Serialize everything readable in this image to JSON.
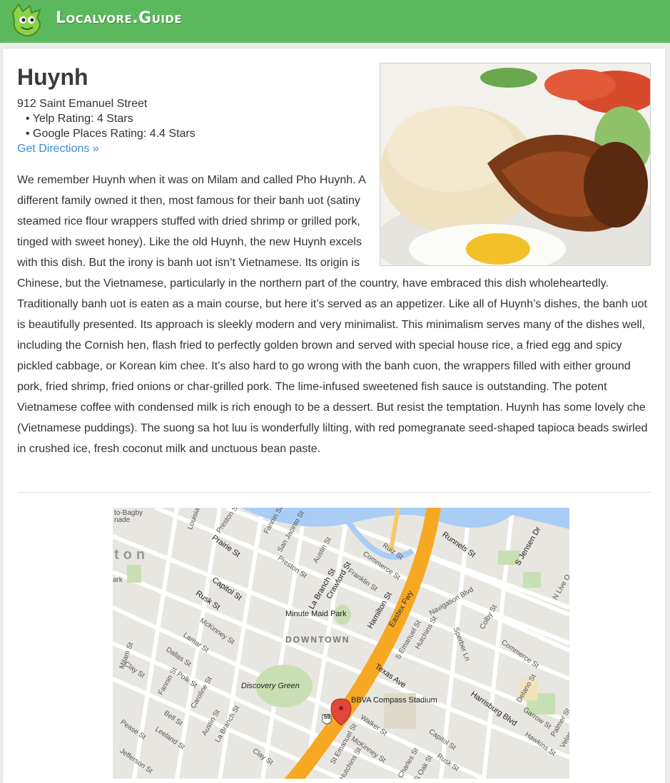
{
  "header": {
    "brand": "Localvore.Guide",
    "logo_icon": "dinosaur-logo-icon",
    "background": "#5cb85c"
  },
  "restaurant": {
    "name": "Huynh",
    "address": "912 Saint Emanuel Street",
    "yelp_rating": "• Yelp Rating: 4 Stars",
    "google_rating": "• Google Places Rating: 4.4 Stars",
    "directions_label": "Get Directions »",
    "photo_icon": "food-photo",
    "description": "We remember Huynh when it was on Milam and called Pho Huynh. A different family owned it then, most famous for their banh uot (satiny steamed rice flour wrappers stuffed with dried shrimp or grilled pork, tinged with sweet honey). Like the old Huynh, the new Huynh excels with this dish. But the irony is banh uot isn’t Vietnamese. Its origin is Chinese, but the Vietnamese, particularly in the northern part of the country, have embraced this dish wholeheartedly.  Traditionally banh uot is eaten as a main course, but here it’s served as an appetizer. Like all of Huynh’s dishes, the banh uot is beautifully presented. Its approach is sleekly modern and very minimalist. This minimalism serves many of the dishes well, including the Cornish hen, flash fried to perfectly golden brown and served with special house rice, a fried egg and spicy pickled cabbage, or Korean kim chee. It’s also hard to go wrong with the banh cuon, the wrappers filled with either ground pork, fried shrimp, fried onions or char-grilled pork. The lime-infused sweetened fish sauce is outstanding. The potent Vietnamese coffee with condensed milk is rich enough to be a dessert. But resist the temptation. Huynh has some lovely che (Vietnamese puddings). The suong sa hot luu is wonderfully lilting, with red pomegranate seed-shaped tapioca beads swirled in crushed ice, fresh coconut milk and unctuous bean paste."
  },
  "map": {
    "labels": {
      "bagby": "to-Bagby",
      "nade": "nade",
      "ton": "ton",
      "ark": "ark",
      "louisiana": "Louisia",
      "preston1": "Preston St",
      "prairie": "Prairie St",
      "fannin1": "Fannin St",
      "san_jacinto": "San Jacinto St",
      "austin1": "Austin St",
      "preston2": "Preston St",
      "capitol1": "Capitol St",
      "rusk1": "Rusk St",
      "la_branch1": "La Branch St",
      "crawford": "Crawford St",
      "commerce1": "Commerce St",
      "franklin": "Franklin St",
      "ruiz": "Ruiz St",
      "runnels": "Runnels St",
      "s_jensen": "S Jensen Dr",
      "minute_maid": "Minute Maid Park",
      "hamilton": "Hamilton St",
      "eastex": "Eastex Fwy",
      "navigation": "Navigation Blvd",
      "colby": "Colby St",
      "mckinney1": "McKinney St",
      "lamar": "Lamar St",
      "downtown": "DOWNTOWN",
      "s_emanuel1": "S Emanuel St",
      "hutchins1": "Hutchins St",
      "sperber": "Sperber Ln",
      "commerce2": "Commerce St",
      "milam": "Milam St",
      "dallas": "Dallas St",
      "clay1": "Clay St",
      "fannin2": "Fannin St",
      "polk": "Polk St",
      "caroline": "Caroline St",
      "discovery": "Discovery Green",
      "texas": "Texas Ave",
      "delano": "Delano St",
      "harrisburg": "Harrisburg Blvd",
      "garrow": "Garrow St",
      "bbva": "BBVA Compass Stadium",
      "bell": "Bell St",
      "austin2": "Austin St",
      "la_branch2": "La Branch St",
      "pease": "Pease St",
      "leeland": "Leeland St",
      "jefferson": "Jefferson St",
      "clay2": "Clay St",
      "s_emanuel2": "St Emanuel St",
      "walker": "Walker St",
      "mckinney2": "McKinney St",
      "hutchins2": "Hutchins St",
      "capitol2": "Capitol St",
      "rusk2": "Rusk St",
      "hawkins": "Hawkins St",
      "st_charles": "St Charles St",
      "oak": "S Oak St",
      "n_live_oak": "N Live O",
      "palmer": "Palmer St",
      "velas": "Velas",
      "highway": "59"
    },
    "marker_icon": "map-pin-icon"
  }
}
